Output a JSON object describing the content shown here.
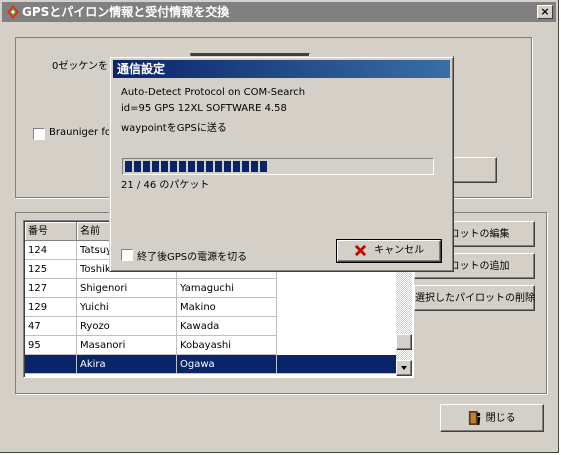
{
  "window": {
    "title": "GPSとパイロン情報と受付情報を交換",
    "close": "×"
  },
  "form": {
    "bib_label": "0ゼッケンを",
    "brauniger_label": "Brauniger for"
  },
  "table": {
    "headers": [
      "番号",
      "名前",
      ""
    ],
    "rows": [
      {
        "id": "124",
        "first": "Tatsuy",
        "last": ""
      },
      {
        "id": "125",
        "first": "Toshik",
        "last": ""
      },
      {
        "id": "127",
        "first": "Shigenori",
        "last": "Yamaguchi"
      },
      {
        "id": "129",
        "first": "Yuichi",
        "last": "Makino"
      },
      {
        "id": "47",
        "first": "Ryozo",
        "last": "Kawada"
      },
      {
        "id": "95",
        "first": "Masanori",
        "last": "Kobayashi"
      },
      {
        "id": "",
        "first": "Akira",
        "last": "Ogawa"
      }
    ],
    "selected_row": 6
  },
  "buttons": {
    "edit_pilot": "イロットの編集",
    "add_pilot": "イロットの追加",
    "delete_pilot": "選択したパイロットの削除",
    "close": "閉じる"
  },
  "dialog": {
    "title": "通信設定",
    "line1": "Auto-Detect Protocol on COM-Search",
    "line2": "id=95  GPS 12XL SOFTWARE  4.58",
    "line3": "waypointをGPSに送る",
    "progress_text": "21 / 46 のパケット",
    "progress_current": 21,
    "progress_total": 46,
    "power_off_label": "終了後GPSの電源を切る",
    "cancel_label": "キャンセル"
  },
  "colors": {
    "face": "#d4d0c8",
    "title_active": "#0a246a",
    "title_inactive": "#808080",
    "selection": "#0a246a",
    "cancel_x": "#cc0000"
  },
  "icons": {
    "app": "gps-pin-icon",
    "cancel": "red-x-icon",
    "close": "door-person-icon"
  }
}
